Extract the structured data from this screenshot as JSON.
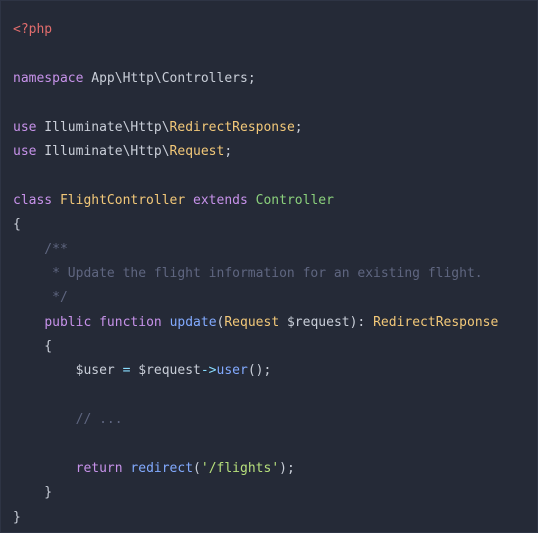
{
  "code": {
    "language": "php",
    "lines": [
      [
        {
          "t": "<?php",
          "c": "php"
        }
      ],
      [],
      [
        {
          "t": "namespace",
          "c": "kw"
        },
        {
          "t": " App\\Http\\Controllers;",
          "c": "plain"
        }
      ],
      [],
      [
        {
          "t": "use",
          "c": "kw"
        },
        {
          "t": " Illuminate\\Http\\",
          "c": "plain"
        },
        {
          "t": "RedirectResponse",
          "c": "class"
        },
        {
          "t": ";",
          "c": "plain"
        }
      ],
      [
        {
          "t": "use",
          "c": "kw"
        },
        {
          "t": " Illuminate\\Http\\",
          "c": "plain"
        },
        {
          "t": "Request",
          "c": "class"
        },
        {
          "t": ";",
          "c": "plain"
        }
      ],
      [],
      [
        {
          "t": "class",
          "c": "kw"
        },
        {
          "t": " ",
          "c": "plain"
        },
        {
          "t": "FlightController",
          "c": "class"
        },
        {
          "t": " ",
          "c": "plain"
        },
        {
          "t": "extends",
          "c": "kw"
        },
        {
          "t": " ",
          "c": "plain"
        },
        {
          "t": "Controller",
          "c": "inh"
        }
      ],
      [
        {
          "t": "{",
          "c": "plain"
        }
      ],
      [
        {
          "t": "    /**",
          "c": "cmt"
        }
      ],
      [
        {
          "t": "     * Update the flight information for an existing flight.",
          "c": "cmt"
        }
      ],
      [
        {
          "t": "     */",
          "c": "cmt"
        }
      ],
      [
        {
          "t": "    ",
          "c": "plain"
        },
        {
          "t": "public",
          "c": "kw"
        },
        {
          "t": " ",
          "c": "plain"
        },
        {
          "t": "function",
          "c": "kw"
        },
        {
          "t": " ",
          "c": "plain"
        },
        {
          "t": "update",
          "c": "fn"
        },
        {
          "t": "(",
          "c": "plain"
        },
        {
          "t": "Request",
          "c": "class"
        },
        {
          "t": " $request",
          "c": "var"
        },
        {
          "t": "): ",
          "c": "plain"
        },
        {
          "t": "RedirectResponse",
          "c": "class"
        }
      ],
      [
        {
          "t": "    {",
          "c": "plain"
        }
      ],
      [
        {
          "t": "        $user ",
          "c": "var"
        },
        {
          "t": "=",
          "c": "op"
        },
        {
          "t": " $request",
          "c": "var"
        },
        {
          "t": "->",
          "c": "op"
        },
        {
          "t": "user",
          "c": "fn"
        },
        {
          "t": "();",
          "c": "plain"
        }
      ],
      [],
      [
        {
          "t": "        // ...",
          "c": "cmt"
        }
      ],
      [],
      [
        {
          "t": "        ",
          "c": "plain"
        },
        {
          "t": "return",
          "c": "kw"
        },
        {
          "t": " ",
          "c": "plain"
        },
        {
          "t": "redirect",
          "c": "fn"
        },
        {
          "t": "(",
          "c": "plain"
        },
        {
          "t": "'/flights'",
          "c": "str"
        },
        {
          "t": ");",
          "c": "plain"
        }
      ],
      [
        {
          "t": "    }",
          "c": "plain"
        }
      ],
      [
        {
          "t": "}",
          "c": "plain"
        }
      ]
    ]
  },
  "colors": {
    "background": "#252a37",
    "keyword": "#c792ea",
    "class": "#f2c879",
    "function": "#82aaff",
    "string": "#b7e07c",
    "comment": "#5f6680",
    "php_tag": "#e06c6c"
  }
}
